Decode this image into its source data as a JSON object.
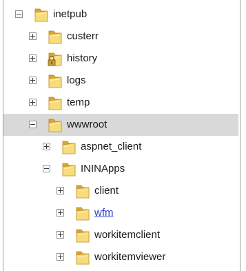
{
  "tree": {
    "items": [
      {
        "label": "inetpub",
        "state": "expanded",
        "level": 0,
        "locked": false,
        "selected": false,
        "link": false
      },
      {
        "label": "custerr",
        "state": "collapsed",
        "level": 1,
        "locked": false,
        "selected": false,
        "link": false
      },
      {
        "label": "history",
        "state": "collapsed",
        "level": 1,
        "locked": true,
        "selected": false,
        "link": false
      },
      {
        "label": "logs",
        "state": "collapsed",
        "level": 1,
        "locked": false,
        "selected": false,
        "link": false
      },
      {
        "label": "temp",
        "state": "collapsed",
        "level": 1,
        "locked": false,
        "selected": false,
        "link": false
      },
      {
        "label": "wwwroot",
        "state": "expanded",
        "level": 1,
        "locked": false,
        "selected": true,
        "link": false
      },
      {
        "label": "aspnet_client",
        "state": "collapsed",
        "level": 2,
        "locked": false,
        "selected": false,
        "link": false
      },
      {
        "label": "ININApps",
        "state": "expanded",
        "level": 2,
        "locked": false,
        "selected": false,
        "link": false
      },
      {
        "label": "client",
        "state": "collapsed",
        "level": 3,
        "locked": false,
        "selected": false,
        "link": false
      },
      {
        "label": "wfm",
        "state": "collapsed",
        "level": 3,
        "locked": false,
        "selected": false,
        "link": true
      },
      {
        "label": "workitemclient",
        "state": "collapsed",
        "level": 3,
        "locked": false,
        "selected": false,
        "link": false
      },
      {
        "label": "workitemviewer",
        "state": "collapsed",
        "level": 3,
        "locked": false,
        "selected": false,
        "link": false
      }
    ]
  },
  "colors": {
    "selection": "#d9d9d9",
    "link": "#2a3ec7",
    "folder_light": "#f7dc7a",
    "folder_dark": "#d9a62c"
  },
  "icons": {
    "folder": "folder-icon",
    "locked_folder": "locked-folder-icon",
    "expand": "plus-expander-icon",
    "collapse": "minus-expander-icon"
  }
}
